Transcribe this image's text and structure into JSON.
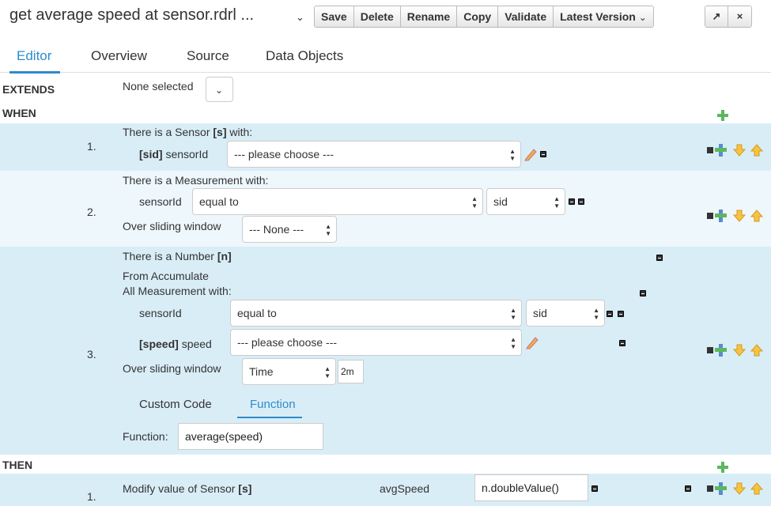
{
  "header": {
    "title": "get average speed at sensor.rdrl ...",
    "toolbar": [
      "Save",
      "Delete",
      "Rename",
      "Copy",
      "Validate",
      "Latest Version"
    ],
    "latest_version_caret": "⌄",
    "maximize_icon": "↗",
    "close_icon": "×"
  },
  "tabs": [
    "Editor",
    "Overview",
    "Source",
    "Data Objects"
  ],
  "extends": {
    "label": "EXTENDS",
    "value": "None selected"
  },
  "when_label": "WHEN",
  "then_label": "THEN",
  "rules": {
    "r1": {
      "num": "1.",
      "line1_prefix": "There is a Sensor",
      "line1_var": "[s]",
      "line1_suffix": "with:",
      "field_var": "[sid]",
      "field_name": "sensorId",
      "select": "--- please choose ---"
    },
    "r2": {
      "num": "2.",
      "line1": "There is a Measurement with:",
      "field": "sensorId",
      "operator": "equal to",
      "value": "sid",
      "window_label": "Over sliding window",
      "window_value": "--- None ---"
    },
    "r3": {
      "num": "3.",
      "line1_prefix": "There is a Number",
      "line1_var": "[n]",
      "line2": "From Accumulate",
      "line3": "All Measurement with:",
      "field1": "sensorId",
      "operator": "equal to",
      "value": "sid",
      "field2_var": "[speed]",
      "field2_name": "speed",
      "select2": "--- please choose ---",
      "window_label": "Over sliding window",
      "window_value": "Time",
      "window_amount": "2m",
      "subtabs": [
        "Custom Code",
        "Function"
      ],
      "function_label": "Function:",
      "function_value": "average(speed)"
    },
    "then1": {
      "num": "1.",
      "text_prefix": "Modify value of Sensor",
      "text_var": "[s]",
      "field": "avgSpeed",
      "value": "n.doubleValue()"
    }
  },
  "colors": {
    "accent": "#2d8ccd",
    "band": "#d9edf7",
    "plus": "#5cb85c",
    "arrow": "#f0ad4e"
  }
}
